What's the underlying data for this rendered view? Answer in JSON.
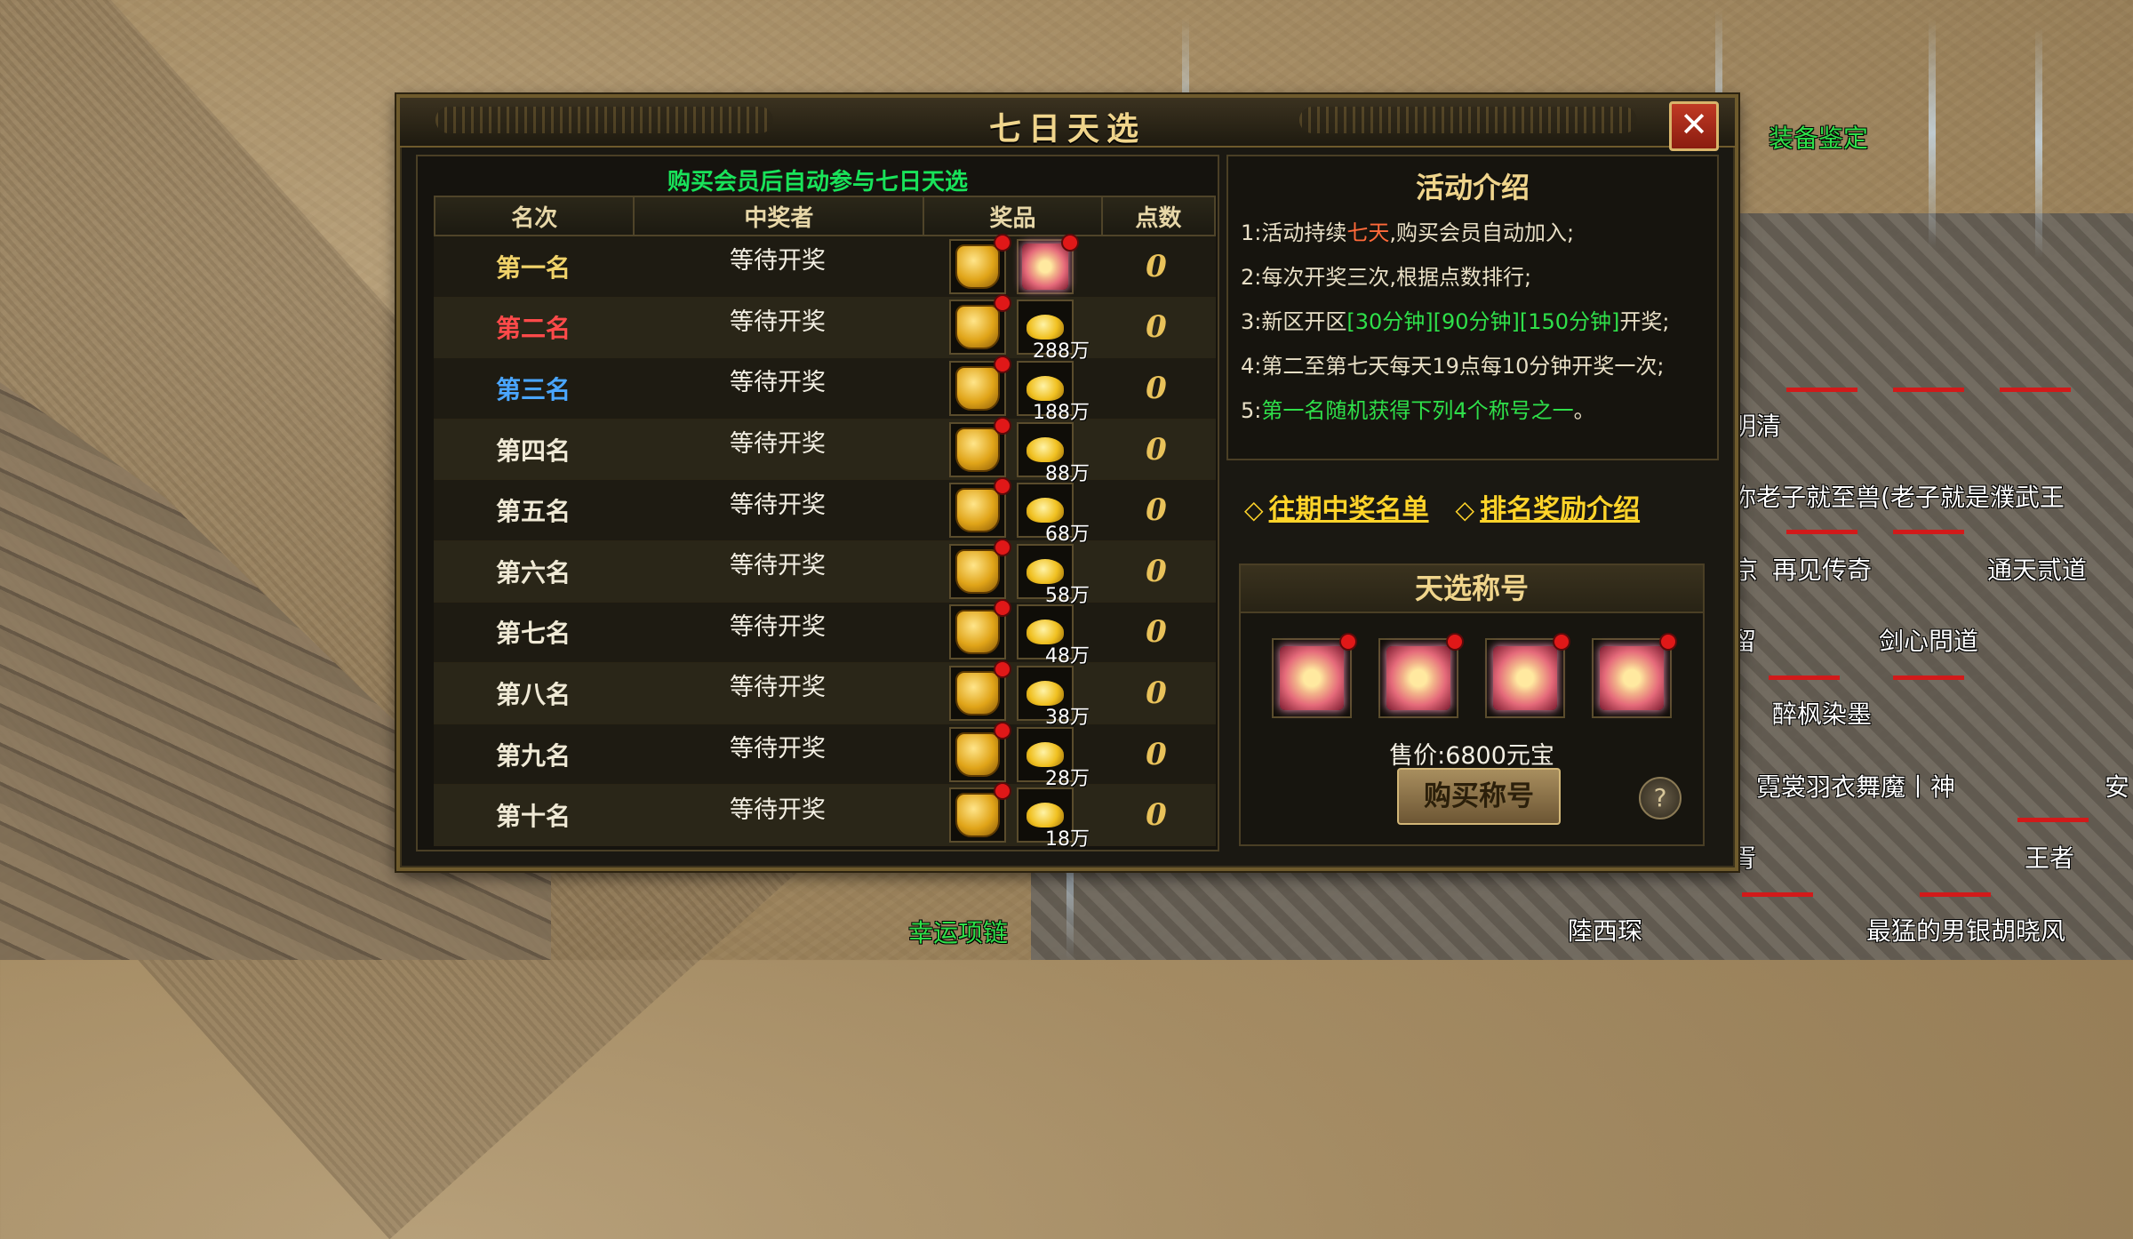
{
  "panel": {
    "title": "七日天选",
    "close_symbol": "✕"
  },
  "left": {
    "notice": "购买会员后自动参与七日天选",
    "headers": [
      "名次",
      "中奖者",
      "奖品",
      "点数"
    ],
    "rows": [
      {
        "rank": "第一名",
        "rank_color": "#f1d36a",
        "winner": "等待开奖",
        "prize_amount": "",
        "prize2_icon": "title-icon",
        "score": "0"
      },
      {
        "rank": "第二名",
        "rank_color": "#ff4a4a",
        "winner": "等待开奖",
        "prize_amount": "288万",
        "prize2_icon": "gold-icon",
        "score": "0"
      },
      {
        "rank": "第三名",
        "rank_color": "#4aa6ff",
        "winner": "等待开奖",
        "prize_amount": "188万",
        "prize2_icon": "gold-icon",
        "score": "0"
      },
      {
        "rank": "第四名",
        "rank_color": "#f0ead6",
        "winner": "等待开奖",
        "prize_amount": "88万",
        "prize2_icon": "gold-icon",
        "score": "0"
      },
      {
        "rank": "第五名",
        "rank_color": "#f0ead6",
        "winner": "等待开奖",
        "prize_amount": "68万",
        "prize2_icon": "gold-icon",
        "score": "0"
      },
      {
        "rank": "第六名",
        "rank_color": "#f0ead6",
        "winner": "等待开奖",
        "prize_amount": "58万",
        "prize2_icon": "gold-icon",
        "score": "0"
      },
      {
        "rank": "第七名",
        "rank_color": "#f0ead6",
        "winner": "等待开奖",
        "prize_amount": "48万",
        "prize2_icon": "gold-icon",
        "score": "0"
      },
      {
        "rank": "第八名",
        "rank_color": "#f0ead6",
        "winner": "等待开奖",
        "prize_amount": "38万",
        "prize2_icon": "gold-icon",
        "score": "0"
      },
      {
        "rank": "第九名",
        "rank_color": "#f0ead6",
        "winner": "等待开奖",
        "prize_amount": "28万",
        "prize2_icon": "gold-icon",
        "score": "0"
      },
      {
        "rank": "第十名",
        "rank_color": "#f0ead6",
        "winner": "等待开奖",
        "prize_amount": "18万",
        "prize2_icon": "gold-icon",
        "score": "0"
      }
    ]
  },
  "intro": {
    "title": "活动介绍",
    "line1_a": "1:活动持续",
    "line1_b": "七天",
    "line1_c": ",购买会员自动加入;",
    "line2": "2:每次开奖三次,根据点数排行;",
    "line3_a": "3:新区开区",
    "line3_b": "[30分钟]",
    "line3_c": "[90分钟]",
    "line3_d": "[150分钟]",
    "line3_e": "开奖;",
    "line4": "4:第二至第七天每天19点每10分钟开奖一次;",
    "line5_a": "5:",
    "line5_b": "第一名随机获得下列4个称号之一",
    "line5_c": "。"
  },
  "links": {
    "history": "往期中奖名单",
    "rewards": "排名奖励介绍",
    "diamond": "◇"
  },
  "titles": {
    "heading": "天选称号",
    "price": "售价:6800元宝",
    "buy": "购买称号",
    "help": "?"
  },
  "scene": {
    "names": [
      {
        "text": "装备鉴定",
        "green": true
      },
      {
        "text": "明清",
        "green": false
      },
      {
        "text": "你老子就至兽(老子就是濮武王",
        "green": false
      },
      {
        "text": "再见传奇",
        "green": false
      },
      {
        "text": "通天贰道",
        "green": false
      },
      {
        "text": "剑心問道",
        "green": false
      },
      {
        "text": "醉枫染墨",
        "green": false
      },
      {
        "text": "霓裳羽衣舞魔丨神",
        "green": false
      },
      {
        "text": "王者",
        "green": false
      },
      {
        "text": "陸西琛",
        "green": false
      },
      {
        "text": "最猛的男银胡晓风",
        "green": false
      },
      {
        "text": "幸运项链",
        "green": true
      },
      {
        "text": "留",
        "green": false
      },
      {
        "text": "安",
        "green": false
      },
      {
        "text": "胥",
        "green": false
      },
      {
        "text": "京",
        "green": false
      }
    ]
  }
}
